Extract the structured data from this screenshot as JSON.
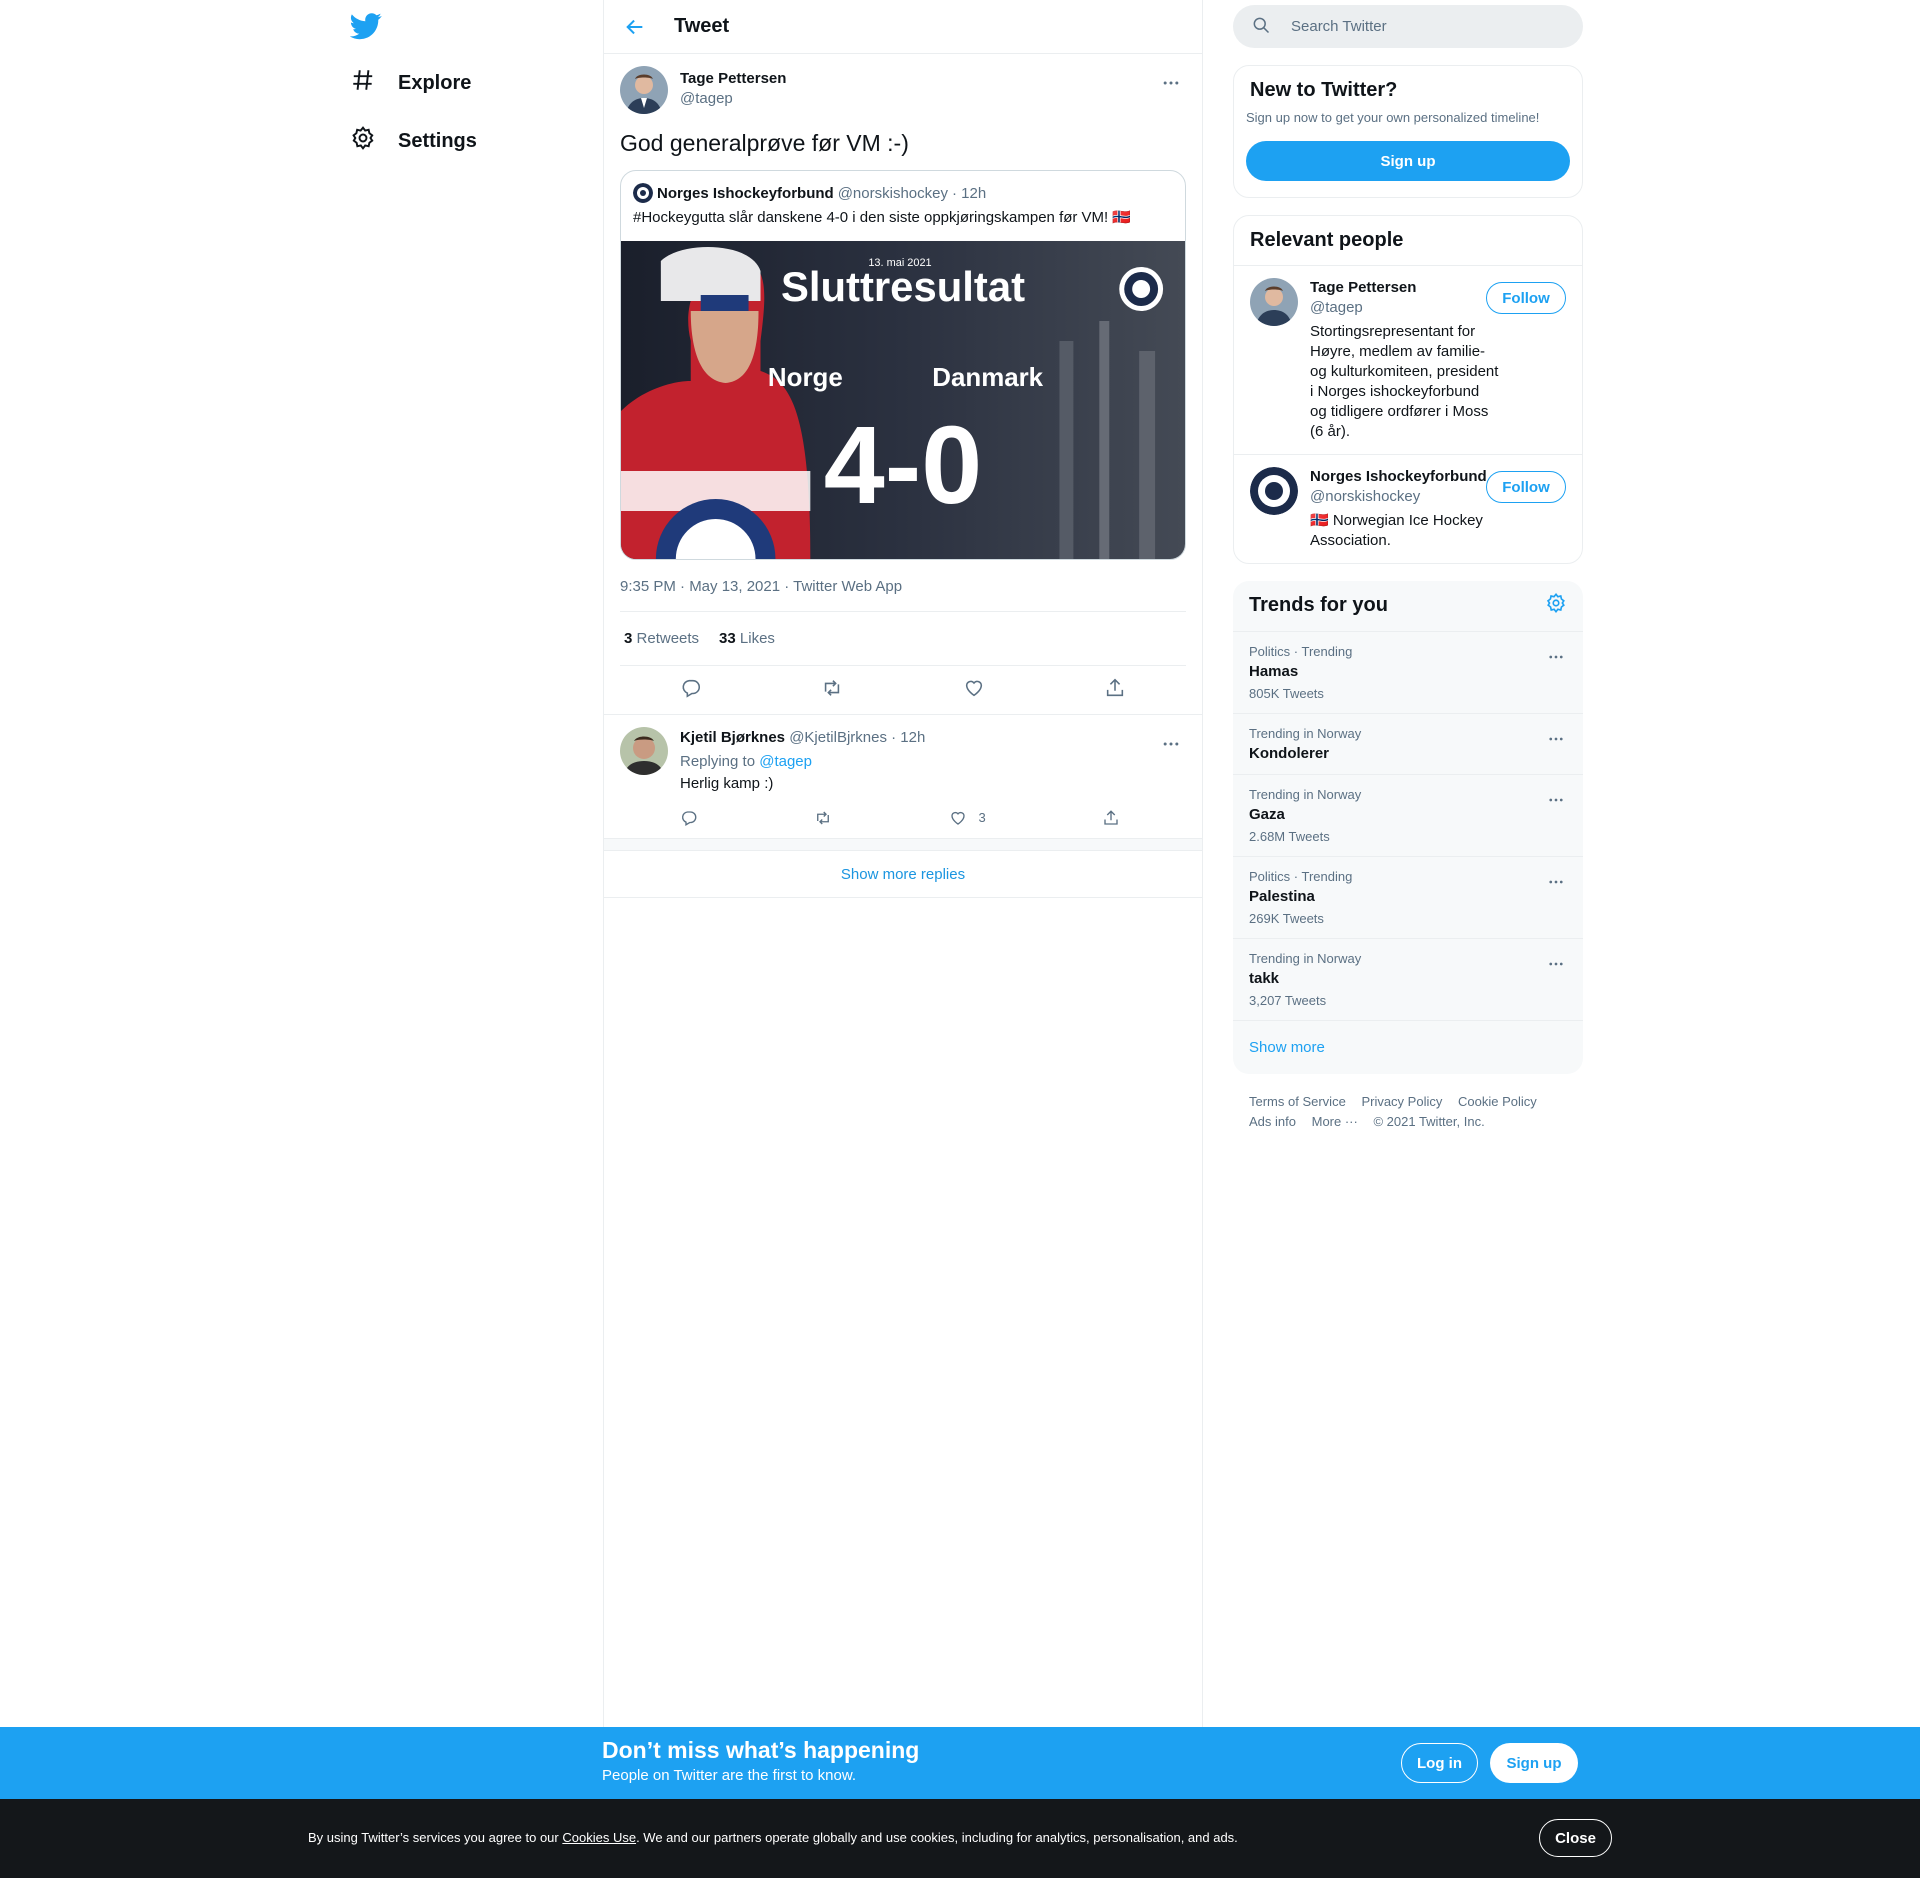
{
  "nav": {
    "logo": "twitter-bird-icon",
    "items": [
      {
        "label": "Explore",
        "icon": "hashtag-icon"
      },
      {
        "label": "Settings",
        "icon": "gear-icon"
      }
    ]
  },
  "header": {
    "title": "Tweet"
  },
  "tweet": {
    "author_name": "Tage Pettersen",
    "author_handle": "@tagep",
    "text": "God generalprøve før VM :-)",
    "quote": {
      "name": "Norges Ishockeyforbund",
      "handle": "@norskishockey",
      "time": "· 12h",
      "text": "#Hockeygutta slår danskene 4-0 i den siste oppkjøringskampen før VM! 🇳🇴",
      "media": {
        "date": "13. mai 2021",
        "title": "Sluttresultat",
        "team_home": "Norge",
        "team_away": "Danmark",
        "score": "4-0"
      }
    },
    "meta": "9:35 PM · May 13, 2021 · Twitter Web App",
    "retweets_count": "3",
    "retweets_label": "Retweets",
    "likes_count": "33",
    "likes_label": "Likes"
  },
  "reply": {
    "name": "Kjetil Bjørknes",
    "handle": "@KjetilBjrknes",
    "time": "· 12h",
    "replying_prefix": "Replying to",
    "replying_handle": "@tagep",
    "text": "Herlig kamp :)",
    "likes": "3"
  },
  "show_more_replies": "Show more replies",
  "sidebar": {
    "search_placeholder": "Search Twitter",
    "new_title": "New to Twitter?",
    "new_sub": "Sign up now to get your own personalized timeline!",
    "signup_label": "Sign up",
    "relevant_title": "Relevant people",
    "people": [
      {
        "name": "Tage Pettersen",
        "handle": "@tagep",
        "bio": "Stortingsrepresentant for Høyre, medlem av familie- og kulturkomiteen, president i Norges ishockeyforbund og tidligere ordfører i Moss (6 år).",
        "follow": "Follow"
      },
      {
        "name": "Norges Ishockeyforbund",
        "handle": "@norskishockey",
        "bio": "🇳🇴 Norwegian Ice Hockey Association.",
        "follow": "Follow"
      }
    ],
    "trends_title": "Trends for you",
    "trends": [
      {
        "context": "Politics · Trending",
        "name": "Hamas",
        "count": "805K Tweets"
      },
      {
        "context": "Trending in Norway",
        "name": "Kondolerer",
        "count": ""
      },
      {
        "context": "Trending in Norway",
        "name": "Gaza",
        "count": "2.68M Tweets"
      },
      {
        "context": "Politics · Trending",
        "name": "Palestina",
        "count": "269K Tweets"
      },
      {
        "context": "Trending in Norway",
        "name": "takk",
        "count": "3,207 Tweets"
      }
    ],
    "show_more": "Show more",
    "footer": {
      "terms": "Terms of Service",
      "privacy": "Privacy Policy",
      "cookie": "Cookie Policy",
      "ads": "Ads info",
      "more": "More ···",
      "copyright": "© 2021 Twitter, Inc."
    }
  },
  "bottom_bar": {
    "title": "Don’t miss what’s happening",
    "subtitle": "People on Twitter are the first to know.",
    "login": "Log in",
    "signup": "Sign up"
  },
  "cookie_bar": {
    "prefix": "By using Twitter’s services you agree to our",
    "link": "Cookies Use",
    "suffix": ". We and our partners operate globally and use cookies, including for analytics, personalisation, and ads.",
    "close": "Close"
  },
  "colors": {
    "accent": "#1da1f2",
    "text": "#0f1419",
    "muted": "#5b7083",
    "border": "#ebeef0"
  }
}
